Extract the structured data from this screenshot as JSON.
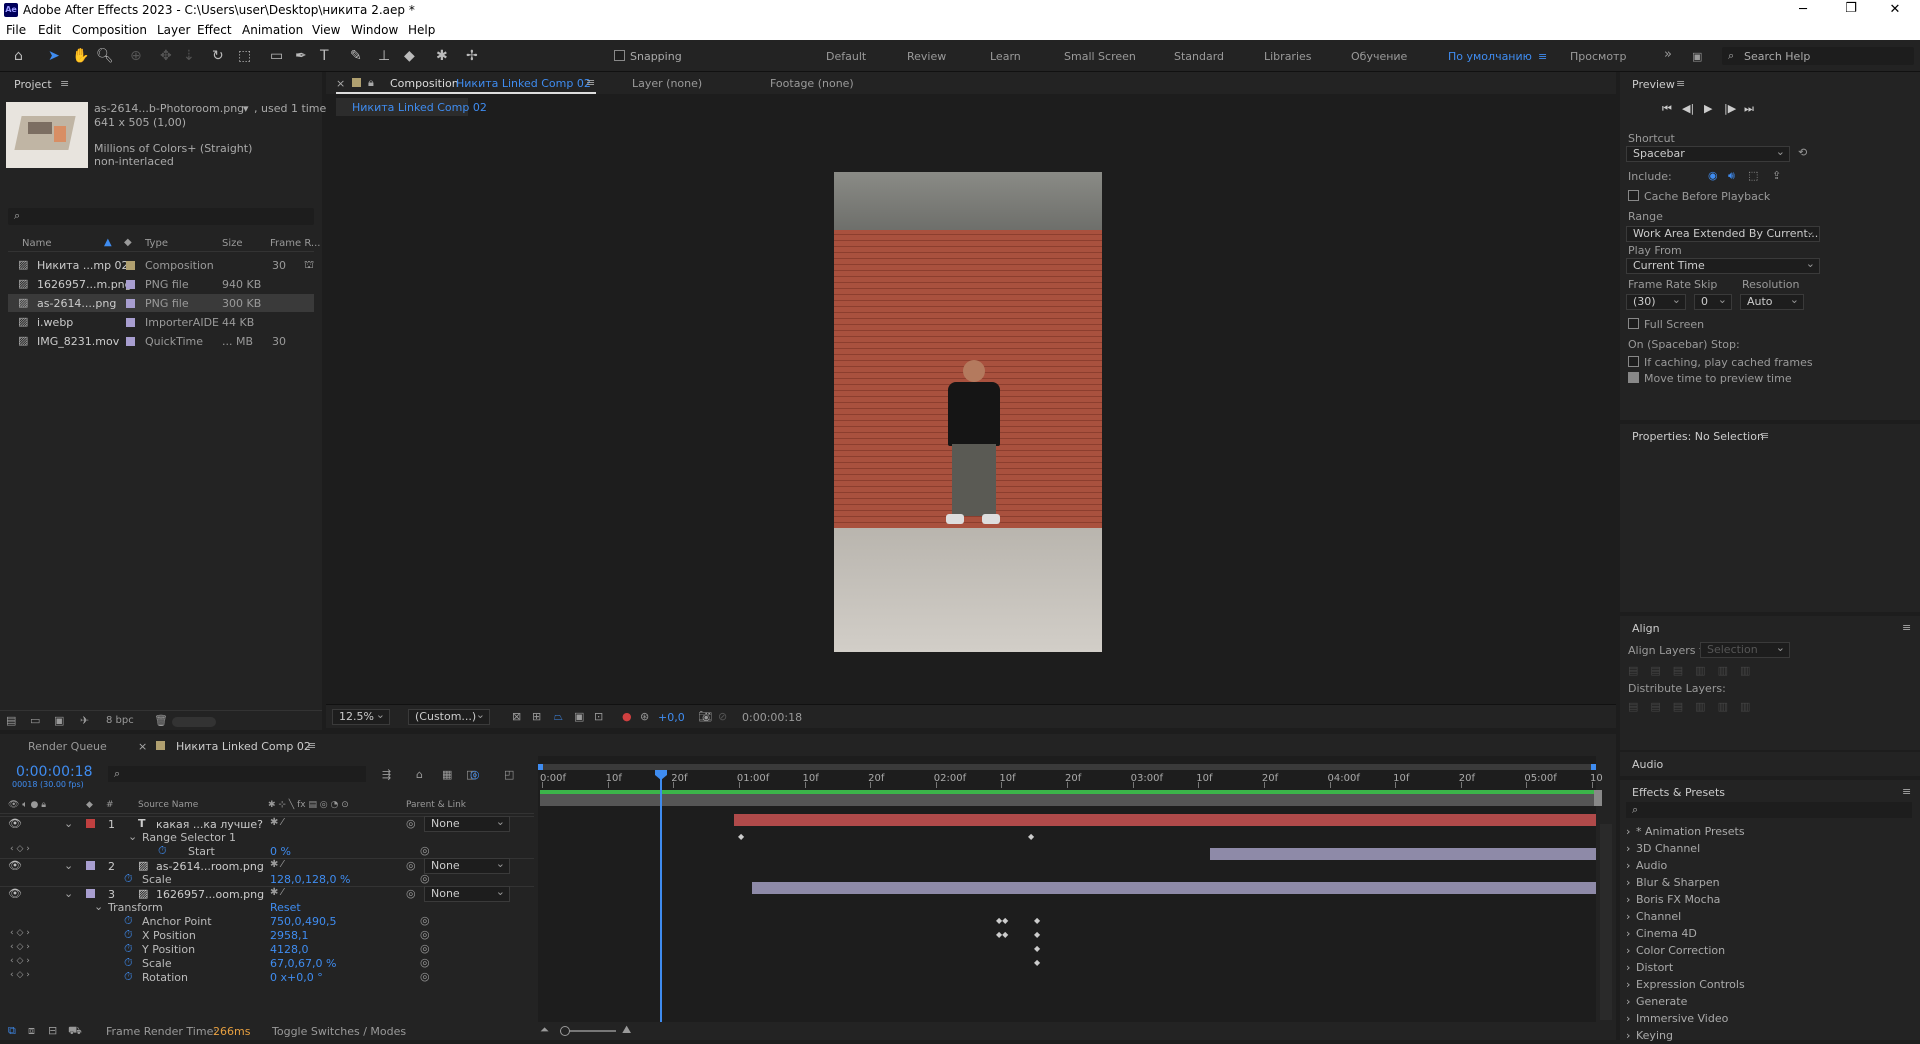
{
  "titlebar": {
    "title": "Adobe After Effects 2023 - C:\\Users\\user\\Desktop\\никита 2.aep *",
    "logo": "Ae",
    "minimize": "─",
    "maximize": "❐",
    "close": "✕"
  },
  "menu": [
    "File",
    "Edit",
    "Composition",
    "Layer",
    "Effect",
    "Animation",
    "View",
    "Window",
    "Help"
  ],
  "toolbar": {
    "snapping": "Snapping",
    "workspaces": [
      "Default",
      "Review",
      "Learn",
      "Small Screen",
      "Standard",
      "Libraries",
      "Обучение",
      "По умолчанию",
      "Просмотр"
    ],
    "active_workspace": "По умолчанию",
    "search_help": "Search Help"
  },
  "project": {
    "tab": "Project",
    "asset_name": "as-2614...b-Photoroom.png",
    "asset_used": ", used 1 time",
    "asset_dims": "641 x 505 (1,00)",
    "asset_colors": "Millions of Colors+ (Straight)",
    "asset_interlace": "non-interlaced",
    "columns": {
      "name": "Name",
      "type": "Type",
      "size": "Size",
      "frame_rate": "Frame R..."
    },
    "items": [
      {
        "name": "Никита ...mp 02",
        "type": "Composition",
        "size": "",
        "fps": "30",
        "color": "#b0a070",
        "icon": "composition-icon"
      },
      {
        "name": "1626957...m.png",
        "type": "PNG file",
        "size": "940 KB",
        "fps": "",
        "color": "#a89ed0",
        "icon": "image-icon"
      },
      {
        "name": "as-2614....png",
        "type": "PNG file",
        "size": "300 KB",
        "fps": "",
        "color": "#a89ed0",
        "icon": "image-icon"
      },
      {
        "name": "i.webp",
        "type": "ImporterAIDE",
        "size": "44 KB",
        "fps": "",
        "color": "#a89ed0",
        "icon": "image-icon"
      },
      {
        "name": "IMG_8231.mov",
        "type": "QuickTime",
        "size": "... MB",
        "fps": "30",
        "color": "#a89ed0",
        "icon": "video-icon"
      }
    ],
    "bpc": "8 bpc"
  },
  "comp": {
    "tab_prefix": "Composition",
    "tab_name": "Никита Linked Comp 02",
    "layer_tab": "Layer (none)",
    "footage_tab": "Footage (none)",
    "subtab": "Никита Linked Comp 02",
    "zoom": "12.5%",
    "resolution": "(Custom...)",
    "exposure": "+0,0",
    "time": "0:00:00:18"
  },
  "preview": {
    "tab": "Preview",
    "shortcut_label": "Shortcut",
    "shortcut_value": "Spacebar",
    "include_label": "Include:",
    "cache_before": "Cache Before Playback",
    "range_label": "Range",
    "range_value": "Work Area Extended By Current...",
    "play_from_label": "Play From",
    "play_from_value": "Current Time",
    "frame_rate_label": "Frame Rate",
    "skip_label": "Skip",
    "resolution_label": "Resolution",
    "frame_rate_value": "(30)",
    "skip_value": "0",
    "resolution_value": "Auto",
    "full_screen": "Full Screen",
    "stop_label": "On (Spacebar) Stop:",
    "if_caching": "If caching, play cached frames",
    "move_time": "Move time to preview time"
  },
  "properties": {
    "title": "Properties: No Selection"
  },
  "align": {
    "title": "Align",
    "align_to_label": "Align Layers to:",
    "align_to_value": "Selection",
    "distribute_label": "Distribute Layers:"
  },
  "audio": {
    "title": "Audio"
  },
  "effects": {
    "title": "Effects & Presets",
    "items": [
      "* Animation Presets",
      "3D Channel",
      "Audio",
      "Blur & Sharpen",
      "Boris FX Mocha",
      "Channel",
      "Cinema 4D",
      "Color Correction",
      "Distort",
      "Expression Controls",
      "Generate",
      "Immersive Video",
      "Keying"
    ]
  },
  "timeline": {
    "render_queue_tab": "Render Queue",
    "comp_tab": "Никита Linked Comp 02",
    "timecode": "0:00:00:18",
    "frame_info": "00018 (30.00 fps)",
    "col_source": "Source Name",
    "col_parent": "Parent & Link",
    "col_num": "#",
    "ruler": [
      "0:00f",
      "10f",
      "20f",
      "01:00f",
      "10f",
      "20f",
      "02:00f",
      "10f",
      "20f",
      "03:00f",
      "10f",
      "20f",
      "04:00f",
      "10f",
      "20f",
      "05:00f",
      "10"
    ],
    "rows": [
      {
        "num": "1",
        "name": "какая ...ка лучше?",
        "parent": "None",
        "color": "#c04040",
        "kind": "layer",
        "type_icon": "T"
      },
      {
        "num": "",
        "name": "Range Selector 1",
        "parent": "",
        "color": "",
        "kind": "group"
      },
      {
        "num": "",
        "name": "Start",
        "value": "0 %",
        "kind": "prop"
      },
      {
        "num": "2",
        "name": "as-2614...room.png",
        "parent": "None",
        "color": "#a89ed0",
        "kind": "layer"
      },
      {
        "num": "",
        "name": "Scale",
        "value": "128,0,128,0 %",
        "kind": "prop"
      },
      {
        "num": "3",
        "name": "1626957...oom.png",
        "parent": "None",
        "color": "#a89ed0",
        "kind": "layer"
      },
      {
        "num": "",
        "name": "Transform",
        "value": "Reset",
        "kind": "group"
      },
      {
        "num": "",
        "name": "Anchor Point",
        "value": "750,0,490,5",
        "kind": "prop"
      },
      {
        "num": "",
        "name": "X Position",
        "value": "2958,1",
        "kind": "prop"
      },
      {
        "num": "",
        "name": "Y Position",
        "value": "4128,0",
        "kind": "prop"
      },
      {
        "num": "",
        "name": "Scale",
        "value": "67,0,67,0 %",
        "kind": "prop"
      },
      {
        "num": "",
        "name": "Rotation",
        "value": "0 x+0,0 °",
        "kind": "prop"
      }
    ],
    "frame_render_label": "Frame Render Time:",
    "frame_render_value": "266ms",
    "toggle_label": "Toggle Switches / Modes"
  },
  "colors": {
    "accent": "#3f8cf0",
    "panel": "#232323",
    "bg": "#1d1d1d",
    "layer1_bar": "#b04a4a",
    "layer_bar": "#8e8aa8"
  }
}
